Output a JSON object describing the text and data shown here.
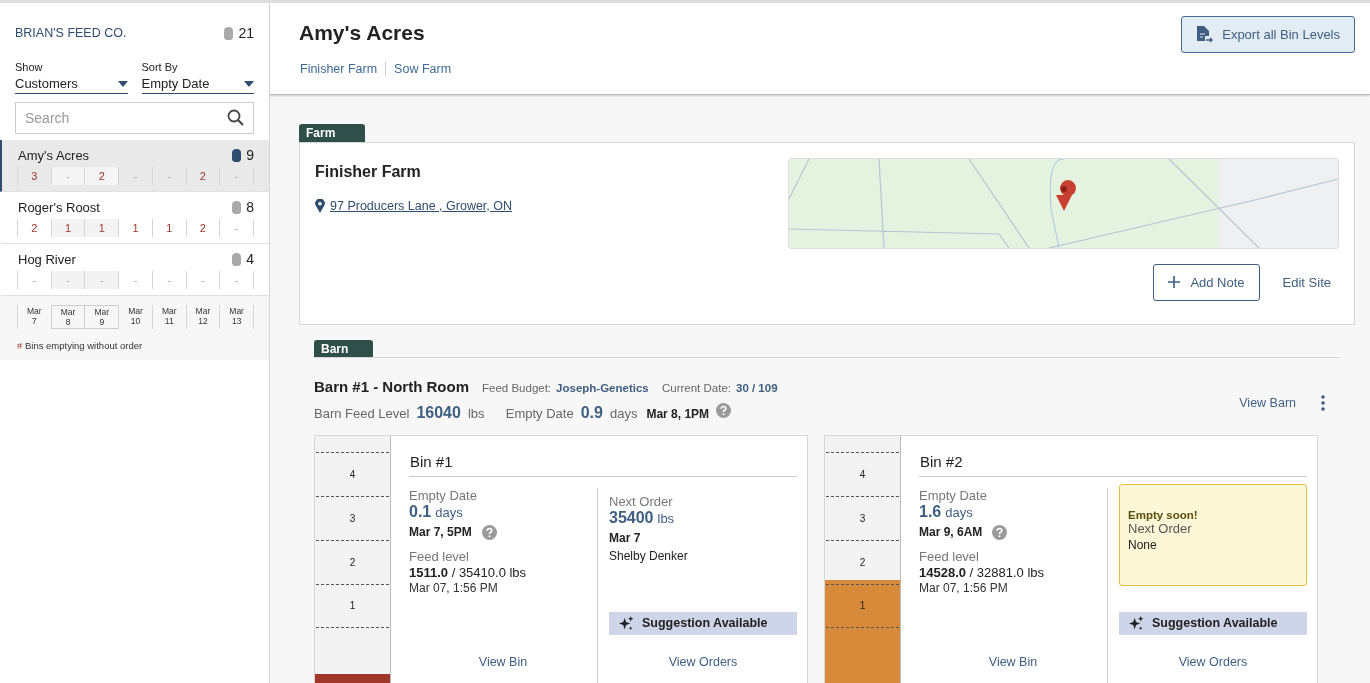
{
  "sidebar": {
    "company": "BRIAN'S FEED CO.",
    "bin_count": "21",
    "filters": [
      {
        "label": "Show",
        "value": "Customers"
      },
      {
        "label": "Sort By",
        "value": "Empty Date"
      }
    ],
    "search": {
      "placeholder": "Search"
    },
    "customers": [
      {
        "name": "Amy's Acres",
        "bin_count": "9",
        "selected": true,
        "cells": [
          "3",
          "-",
          "2",
          "-",
          "-",
          "2",
          "-"
        ]
      },
      {
        "name": "Roger's Roost",
        "bin_count": "8",
        "selected": false,
        "cells": [
          "2",
          "1",
          "1",
          "1",
          "1",
          "2",
          "-"
        ]
      },
      {
        "name": "Hog River",
        "bin_count": "4",
        "selected": false,
        "cells": [
          "-",
          "-",
          "-",
          "-",
          "-",
          "-",
          "-"
        ]
      }
    ],
    "days": [
      {
        "month": "Mar",
        "day": "7",
        "highlighted": false
      },
      {
        "month": "Mar",
        "day": "8",
        "highlighted": true
      },
      {
        "month": "Mar",
        "day": "9",
        "highlighted": true
      },
      {
        "month": "Mar",
        "day": "10",
        "highlighted": false
      },
      {
        "month": "Mar",
        "day": "11",
        "highlighted": false
      },
      {
        "month": "Mar",
        "day": "12",
        "highlighted": false
      },
      {
        "month": "Mar",
        "day": "13",
        "highlighted": false
      }
    ],
    "legend": {
      "mark": "#",
      "text": "Bins emptying without order"
    }
  },
  "header": {
    "title": "Amy's Acres",
    "links": [
      "Finisher Farm",
      "Sow Farm"
    ],
    "export_button": "Export all Bin Levels"
  },
  "farm": {
    "tag": "Farm",
    "name": "Finisher Farm",
    "address": "97 Producers Lane , Grower, ON",
    "buttons": [
      {
        "label": "Add Note",
        "kind": "outlined"
      },
      {
        "label": "Edit Site",
        "kind": "link"
      }
    ]
  },
  "barn": {
    "tag": "Barn",
    "name": "Barn #1 - North Room",
    "feed_budget_label": "Feed Budget:",
    "feed_budget": "Joseph-Genetics",
    "current_date_label": "Current Date:",
    "current_date": "30 / 109",
    "feed_level_label": "Barn Feed Level",
    "feed_level": "16040",
    "feed_level_unit": "lbs",
    "empty_label": "Empty Date",
    "empty_days": "0.9",
    "empty_unit": "days",
    "empty_date": "Mar 8, 1PM",
    "view_button": "View Barn"
  },
  "bins": [
    {
      "name": "Bin #1",
      "level": 0.04,
      "color": "#a0372a",
      "gauge_marks": [
        "4",
        "3",
        "2",
        "1"
      ],
      "empty_label": "Empty Date",
      "empty_days": "0.1",
      "empty_unit": "days",
      "empty_date": "Mar 7, 5PM",
      "feed_label": "Feed level",
      "feed_current": "1511.0",
      "feed_capacity": "/ 35410.0 lbs",
      "reading_time": "Mar 07, 1:56 PM",
      "order": {
        "kind": "order",
        "label": "Next Order",
        "amount": "35400",
        "unit": "lbs",
        "date": "Mar 7",
        "person": "Shelby Denker"
      },
      "suggestion": "Suggestion Available",
      "view_bin": "View Bin",
      "view_orders": "View Orders"
    },
    {
      "name": "Bin #2",
      "level": 0.42,
      "color": "#d68a3a",
      "gauge_marks": [
        "4",
        "3",
        "2",
        "1"
      ],
      "empty_label": "Empty Date",
      "empty_days": "1.6",
      "empty_unit": "days",
      "empty_date": "Mar 9, 6AM",
      "feed_label": "Feed level",
      "feed_current": "14528.0",
      "feed_capacity": "/ 32881.0 lbs",
      "reading_time": "Mar 07, 1:56 PM",
      "order": {
        "kind": "warning",
        "alert": "Empty soon!",
        "label": "Next Order",
        "value": "None"
      },
      "suggestion": "Suggestion Available",
      "view_bin": "View Bin",
      "view_orders": "View Orders"
    }
  ]
}
